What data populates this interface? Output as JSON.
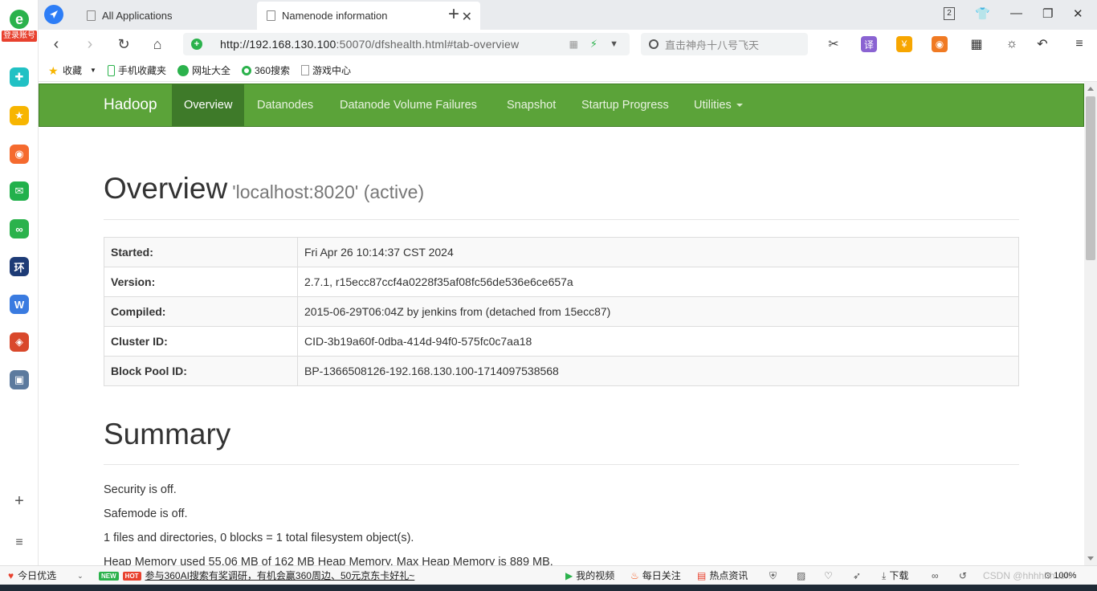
{
  "sidebar": {
    "account_label": "登录账号",
    "logo_letter": "e",
    "apps": [
      {
        "icon": "plus-cross-icon",
        "color": "#21c1c4",
        "glyph": "✚"
      },
      {
        "icon": "star-icon",
        "color": "#f7b500",
        "glyph": "★"
      },
      {
        "icon": "weibo-icon",
        "color": "#f56a2e",
        "glyph": "◉"
      },
      {
        "icon": "mail-icon",
        "color": "#22b14c",
        "glyph": "✉"
      },
      {
        "icon": "link-icon",
        "color": "#2bb24c",
        "glyph": "∞"
      },
      {
        "icon": "news-icon",
        "color": "#1d3b76",
        "glyph": "环"
      },
      {
        "icon": "doc-icon",
        "color": "#3a7be0",
        "glyph": "W"
      },
      {
        "icon": "game-icon",
        "color": "#d9482b",
        "glyph": "◈"
      },
      {
        "icon": "game2-icon",
        "color": "#5c7a9e",
        "glyph": "▣"
      }
    ],
    "add_glyph": "+",
    "menu_glyph": "≡"
  },
  "tabs": [
    {
      "label": "All Applications",
      "active": false
    },
    {
      "label": "Namenode information",
      "active": true
    }
  ],
  "window": {
    "tab_count": "2"
  },
  "address_bar": {
    "url_host": "http://192.168.130.100",
    "url_rest": ":50070/dfshealth.html#tab-overview"
  },
  "search": {
    "placeholder": "直击神舟十八号飞天"
  },
  "bookmarks": [
    {
      "label": "收藏",
      "icon": "star-icon"
    },
    {
      "label": "手机收藏夹",
      "icon": "phone-icon"
    },
    {
      "label": "网址大全",
      "icon": "site-directory-icon"
    },
    {
      "label": "360搜索",
      "icon": "search-360-icon"
    },
    {
      "label": "游戏中心",
      "icon": "doc-icon"
    }
  ],
  "hadoop_nav": {
    "brand": "Hadoop",
    "items": [
      "Overview",
      "Datanodes",
      "Datanode Volume Failures",
      "Snapshot",
      "Startup Progress",
      "Utilities"
    ]
  },
  "overview": {
    "title": "Overview",
    "subtitle": "'localhost:8020' (active)",
    "rows": [
      {
        "key": "Started:",
        "value": "Fri Apr 26 10:14:37 CST 2024"
      },
      {
        "key": "Version:",
        "value": "2.7.1, r15ecc87ccf4a0228f35af08fc56de536e6ce657a"
      },
      {
        "key": "Compiled:",
        "value": "2015-06-29T06:04Z by jenkins from (detached from 15ecc87)"
      },
      {
        "key": "Cluster ID:",
        "value": "CID-3b19a60f-0dba-414d-94f0-575fc0c7aa18"
      },
      {
        "key": "Block Pool ID:",
        "value": "BP-1366508126-192.168.130.100-1714097538568"
      }
    ]
  },
  "summary": {
    "title": "Summary",
    "lines": [
      "Security is off.",
      "Safemode is off.",
      "1 files and directories, 0 blocks = 1 total filesystem object(s).",
      "Heap Memory used 55.06 MB of 162 MB Heap Memory. Max Heap Memory is 889 MB."
    ]
  },
  "statusbar": {
    "today": "今日优选",
    "badge_new": "NEW",
    "badge_hot": "HOT",
    "news": "参与360AI搜索有奖调研，有机会赢360周边、50元京东卡好礼~",
    "my_video": "我的视频",
    "daily": "每日关注",
    "hot_news": "热点资讯",
    "download": "下载",
    "zoom": "100%",
    "watermark": "CSDN @hhhhhhush"
  }
}
